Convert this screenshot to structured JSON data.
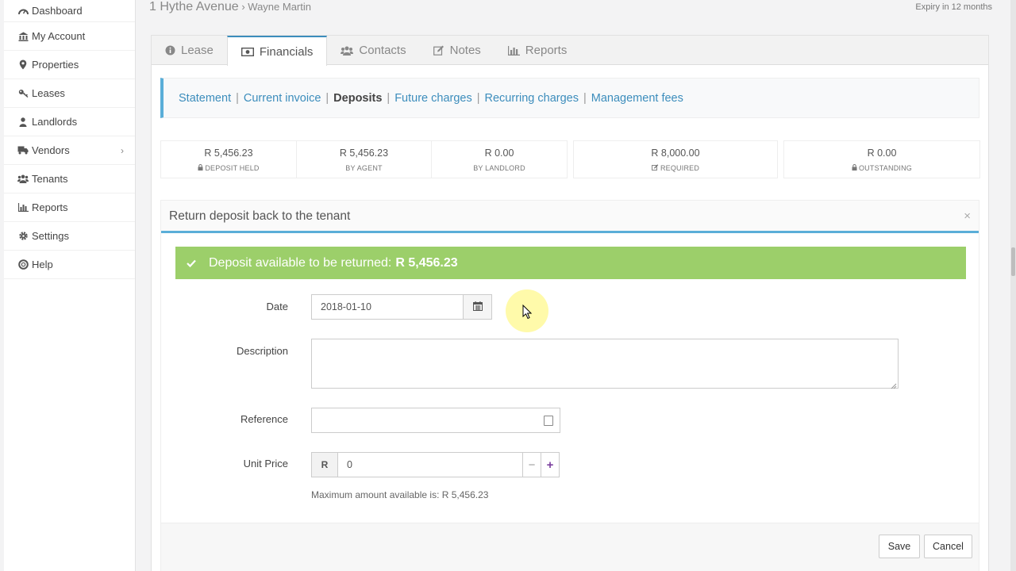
{
  "sidebar": {
    "items": [
      {
        "label": "Dashboard",
        "icon": "dashboard-icon"
      },
      {
        "label": "My Account",
        "icon": "bank-icon"
      },
      {
        "label": "Properties",
        "icon": "map-marker-icon"
      },
      {
        "label": "Leases",
        "icon": "key-icon"
      },
      {
        "label": "Landlords",
        "icon": "user-icon"
      },
      {
        "label": "Vendors",
        "icon": "truck-icon"
      },
      {
        "label": "Tenants",
        "icon": "users-icon"
      },
      {
        "label": "Reports",
        "icon": "bar-chart-icon"
      },
      {
        "label": "Settings",
        "icon": "gear-icon"
      },
      {
        "label": "Help",
        "icon": "life-ring-icon"
      }
    ]
  },
  "header": {
    "property": "1 Hythe Avenue",
    "separator": "›",
    "tenant": "Wayne Martin",
    "expiry": "Expiry in 12 months"
  },
  "tabs": [
    {
      "label": "Lease",
      "icon": "info-circle-icon"
    },
    {
      "label": "Financials",
      "icon": "money-icon",
      "active": true
    },
    {
      "label": "Contacts",
      "icon": "users-icon"
    },
    {
      "label": "Notes",
      "icon": "edit-icon"
    },
    {
      "label": "Reports",
      "icon": "bar-chart-icon"
    }
  ],
  "subnav": {
    "statement": "Statement",
    "current_invoice": "Current invoice",
    "deposits": "Deposits",
    "future_charges": "Future charges",
    "recurring_charges": "Recurring charges",
    "management_fees": "Management fees",
    "separator": "|"
  },
  "stats": [
    {
      "value": "R 5,456.23",
      "label": "DEPOSIT HELD",
      "icon": "lock-icon"
    },
    {
      "value": "R 5,456.23",
      "label": "BY AGENT"
    },
    {
      "value": "R 0.00",
      "label": "BY LANDLORD"
    },
    {
      "value": "R 8,000.00",
      "label": "REQUIRED",
      "icon": "edit-icon"
    },
    {
      "value": "R 0.00",
      "label": "OUTSTANDING",
      "icon": "lock-icon"
    }
  ],
  "modal": {
    "title": "Return deposit back to the tenant",
    "close": "×",
    "alert_text": "Deposit available to be returned:",
    "alert_amount": "R 5,456.23",
    "date_label": "Date",
    "date_value": "2018-01-10",
    "description_label": "Description",
    "reference_label": "Reference",
    "unit_price_label": "Unit Price",
    "currency": "R",
    "unit_price_value": "0",
    "minus": "−",
    "plus": "+",
    "help": "Maximum amount available is: R 5,456.23",
    "save": "Save",
    "cancel": "Cancel"
  },
  "colors": {
    "accent": "#3c8dbc",
    "alert_green": "#9ccf6a",
    "plus_purple": "#7b3f9e"
  }
}
